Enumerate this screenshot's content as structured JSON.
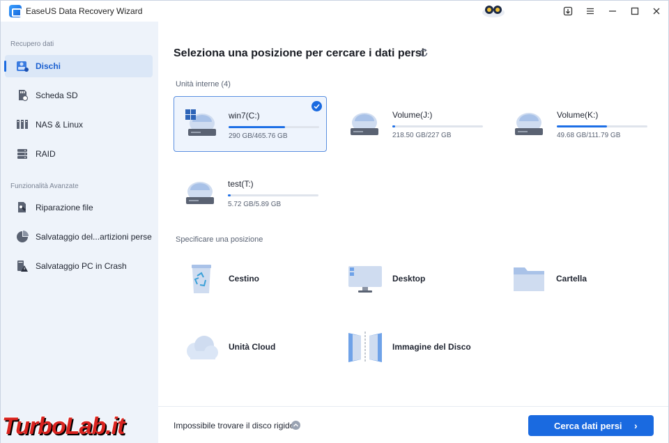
{
  "window": {
    "title": "EaseUS Data Recovery Wizard"
  },
  "titlebar": {
    "icons": [
      "mascot-icon",
      "upgrade-icon",
      "menu-icon",
      "minimize-icon",
      "maximize-icon",
      "close-icon"
    ]
  },
  "sidebar": {
    "section1": "Recupero dati",
    "section2": "Funzionalità Avanzate",
    "items": [
      {
        "label": "Dischi",
        "icon": "disks-icon",
        "active": true
      },
      {
        "label": "Scheda SD",
        "icon": "sd-card-icon"
      },
      {
        "label": "NAS & Linux",
        "icon": "nas-icon"
      },
      {
        "label": "RAID",
        "icon": "raid-icon"
      },
      {
        "label": "Riparazione file",
        "icon": "file-repair-icon"
      },
      {
        "label": "Salvataggio del...artizioni perse",
        "icon": "partition-icon"
      },
      {
        "label": "Salvataggio PC in Crash",
        "icon": "crash-pc-icon"
      }
    ]
  },
  "main": {
    "title": "Seleziona una posizione per cercare i dati persi",
    "internal_label": "Unità interne (4)",
    "drives": [
      {
        "name": "win7(C:)",
        "size": "290 GB/465.76 GB",
        "used_fraction": 0.62,
        "selected": true
      },
      {
        "name": "Volume(J:)",
        "size": "218.50 GB/227 GB",
        "used_fraction": 0.03
      },
      {
        "name": "Volume(K:)",
        "size": "49.68 GB/111.79 GB",
        "used_fraction": 0.55
      },
      {
        "name": "test(T:)",
        "size": "5.72 GB/5.89 GB",
        "used_fraction": 0.03
      }
    ],
    "location_label": "Specificare una posizione",
    "locations": [
      {
        "label": "Cestino",
        "icon": "recycle-bin-icon"
      },
      {
        "label": "Desktop",
        "icon": "desktop-icon"
      },
      {
        "label": "Cartella",
        "icon": "folder-icon"
      },
      {
        "label": "Unità Cloud",
        "icon": "cloud-icon"
      },
      {
        "label": "Immagine del Disco",
        "icon": "disk-image-icon"
      }
    ]
  },
  "footer": {
    "help_text": "Impossibile trovare il disco rigido?",
    "scan_label": "Cerca dati persi"
  },
  "watermark": "TurboLab.it"
}
